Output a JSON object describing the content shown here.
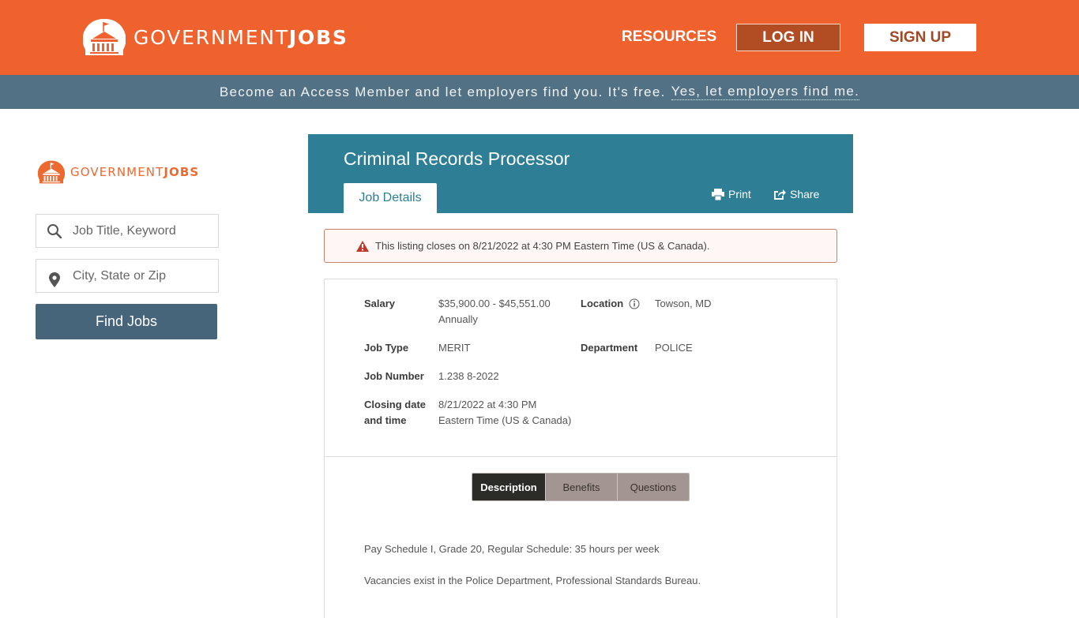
{
  "header": {
    "logo_text_regular": "GOVERNMENT",
    "logo_text_bold": "JOBS",
    "resources_label": "RESOURCES",
    "login_label": "LOG IN",
    "signup_label": "SIGN UP",
    "brand_color": "#f0622d"
  },
  "access_bar": {
    "message": "Become an Access Member and let employers find you. It's free.",
    "link_label": "Yes, let employers find me."
  },
  "sidebar": {
    "logo_text_regular": "GOVERNMENT",
    "logo_text_bold": "JOBS",
    "keyword_placeholder": "Job Title, Keyword",
    "keyword_value": "",
    "location_placeholder": "City, State or Zip",
    "location_value": "",
    "find_jobs_label": "Find Jobs"
  },
  "job": {
    "title": "Criminal Records Processor",
    "tab_label": "Job Details",
    "print_label": "Print",
    "share_label": "Share",
    "alert": "This listing closes on 8/21/2022 at 4:30 PM Eastern Time (US & Canada).",
    "fields": {
      "salary_label": "Salary",
      "salary_value": "$35,900.00 - $45,551.00",
      "salary_period": "Annually",
      "location_label": "Location",
      "location_value": "Towson, MD",
      "job_type_label": "Job Type",
      "job_type_value": "MERIT",
      "department_label": "Department",
      "department_value": "POLICE",
      "job_number_label": "Job Number",
      "job_number_value": "1.238 8-2022",
      "closing_label_line1": "Closing date",
      "closing_label_line2": "and time",
      "closing_value_line1": "8/21/2022 at 4:30 PM",
      "closing_value_line2": "Eastern Time (US & Canada)"
    },
    "content_tabs": [
      {
        "label": "Description",
        "active": true
      },
      {
        "label": "Benefits",
        "active": false
      },
      {
        "label": "Questions",
        "active": false
      }
    ],
    "description": [
      "Pay Schedule I, Grade 20, Regular Schedule:  35 hours per week",
      "Vacancies exist in the Police Department, Professional Standards Bureau."
    ]
  }
}
